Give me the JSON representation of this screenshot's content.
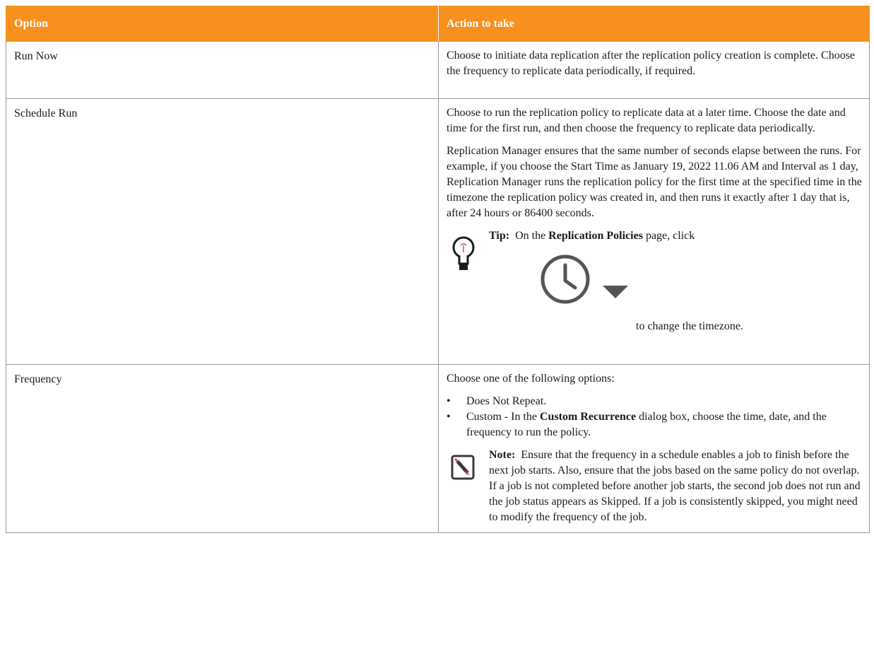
{
  "table": {
    "headers": [
      "Option",
      "Action to take"
    ],
    "run_now": {
      "option": "Run Now",
      "action": "Choose to initiate data replication after the replication policy creation is complete. Choose the frequency to replicate data periodically, if required."
    },
    "schedule_run": {
      "option": "Schedule Run",
      "para1": "Choose to run the replication policy to replicate data at a later time. Choose the date and time for the first run, and then choose the frequency to replicate data periodically.",
      "para2": "Replication Manager ensures that the same number of seconds elapse between the runs. For example, if you choose the Start Time as January 19, 2022 11.06 AM and Interval as 1 day, Replication Manager runs the replication policy for the first time at the specified time in the timezone the replication policy was created in, and then runs it exactly after 1 day that is, after 24 hours or 86400 seconds.",
      "tip": {
        "label": "Tip:",
        "pre": "On the",
        "bold": "Replication Policies",
        "post": "page, click",
        "trail": "to change the timezone."
      }
    },
    "frequency": {
      "option": "Frequency",
      "intro": "Choose one of the following options:",
      "item1": "Does Not Repeat.",
      "item2_pre": "Custom - In the",
      "item2_bold": "Custom Recurrence",
      "item2_post": "dialog box, choose the time, date, and the frequency to run the policy.",
      "note": {
        "label": "Note:",
        "text": "Ensure that the frequency in a schedule enables a job to finish before the next job starts. Also, ensure that the jobs based on the same policy do not overlap. If a job is not completed before another job starts, the second job does not run and the job status appears as Skipped. If a job is consistently skipped, you might need to modify the frequency of the job."
      }
    }
  },
  "colors": {
    "header_bg": "#f7901e",
    "header_text": "#ffffff",
    "border": "#9a9a9a"
  },
  "icons": [
    "lightbulb-icon",
    "clock-icon",
    "caret-down-icon",
    "note-pencil-icon"
  ]
}
